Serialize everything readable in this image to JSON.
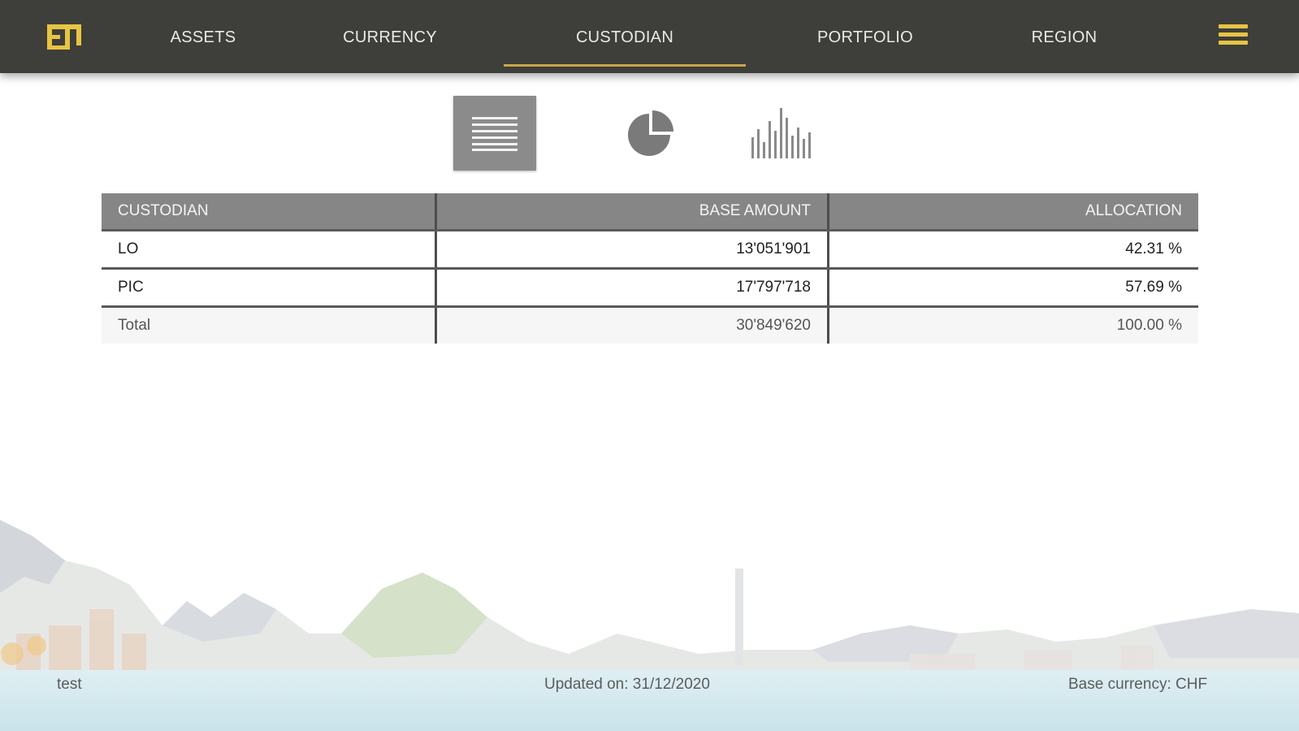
{
  "nav": {
    "logo_text": "FT",
    "items": [
      {
        "label": "ASSETS",
        "active": false
      },
      {
        "label": "CURRENCY",
        "active": false
      },
      {
        "label": "CUSTODIAN",
        "active": true
      },
      {
        "label": "PORTFOLIO",
        "active": false
      },
      {
        "label": "REGION",
        "active": false
      }
    ],
    "menu_icon": "hamburger-icon",
    "accent_color": "#e8c443",
    "active_underline_color": "#c9a64a"
  },
  "view_toggles": [
    {
      "icon": "table-view-icon",
      "active": true
    },
    {
      "icon": "pie-chart-icon",
      "active": false
    },
    {
      "icon": "bar-chart-icon",
      "active": false
    }
  ],
  "table": {
    "headers": [
      "CUSTODIAN",
      "BASE AMOUNT",
      "ALLOCATION"
    ],
    "rows": [
      {
        "custodian": "LO",
        "base_amount": "13'051'901",
        "allocation": "42.31 %"
      },
      {
        "custodian": "PIC",
        "base_amount": "17'797'718",
        "allocation": "57.69 %"
      }
    ],
    "total": {
      "label": "Total",
      "base_amount": "30'849'620",
      "allocation": "100.00 %"
    }
  },
  "footer": {
    "user": "test",
    "updated": "Updated on: 31/12/2020",
    "base_currency": "Base currency: CHF"
  }
}
